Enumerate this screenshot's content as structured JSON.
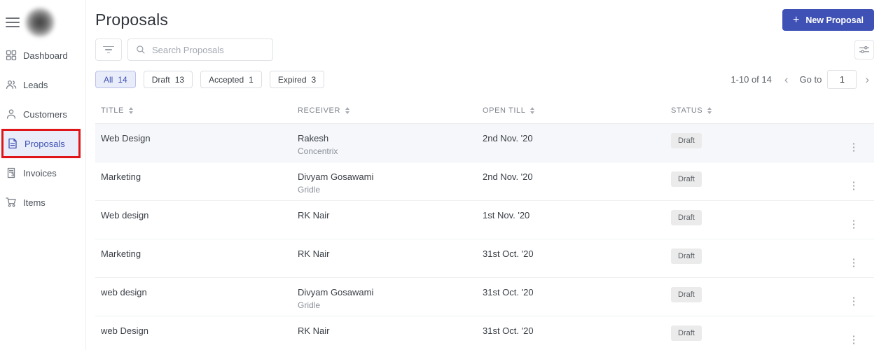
{
  "colors": {
    "accent": "#3f51b5",
    "annotation_red": "#e0151a",
    "chip_active_bg": "#e9ecf9",
    "row_highlight_bg": "#f5f7fa",
    "badge_bg": "#ebebeb"
  },
  "sidebar": {
    "items": [
      {
        "label": "Dashboard",
        "icon": "dashboard-grid-icon",
        "active": false
      },
      {
        "label": "Leads",
        "icon": "leads-people-icon",
        "active": false
      },
      {
        "label": "Customers",
        "icon": "customer-person-icon",
        "active": false
      },
      {
        "label": "Proposals",
        "icon": "proposal-document-icon",
        "active": true,
        "annotated": true
      },
      {
        "label": "Invoices",
        "icon": "invoice-receipt-icon",
        "active": false
      },
      {
        "label": "Items",
        "icon": "cart-icon",
        "active": false
      }
    ]
  },
  "header": {
    "title": "Proposals",
    "new_button": {
      "label": "New Proposal",
      "icon": "plus-icon",
      "plus": "+"
    }
  },
  "toolbar": {
    "search_placeholder": "Search Proposals"
  },
  "filters": {
    "chips": [
      {
        "label": "All",
        "count": "14",
        "active": true
      },
      {
        "label": "Draft",
        "count": "13",
        "active": false
      },
      {
        "label": "Accepted",
        "count": "1",
        "active": false
      },
      {
        "label": "Expired",
        "count": "3",
        "active": false
      }
    ]
  },
  "pagination": {
    "range": "1-10 of 14",
    "prev": "‹",
    "goto_label": "Go to",
    "page_value": "1",
    "next": "›"
  },
  "table": {
    "columns": [
      "TITLE",
      "RECEIVER",
      "OPEN TILL",
      "STATUS"
    ],
    "kebab_glyph": "⋮",
    "rows": [
      {
        "title": "Web Design",
        "receiver": "Rakesh",
        "company": "Concentrix",
        "open_till": "2nd Nov. '20",
        "status": "Draft",
        "highlighted": true
      },
      {
        "title": "Marketing",
        "receiver": "Divyam Gosawami",
        "company": "Gridle",
        "open_till": "2nd Nov. '20",
        "status": "Draft",
        "highlighted": false
      },
      {
        "title": "Web design",
        "receiver": "RK Nair",
        "company": "",
        "open_till": "1st Nov. '20",
        "status": "Draft",
        "highlighted": false
      },
      {
        "title": "Marketing",
        "receiver": "RK Nair",
        "company": "",
        "open_till": "31st Oct. '20",
        "status": "Draft",
        "highlighted": false
      },
      {
        "title": "web design",
        "receiver": "Divyam Gosawami",
        "company": "Gridle",
        "open_till": "31st Oct. '20",
        "status": "Draft",
        "highlighted": false
      },
      {
        "title": "web Design",
        "receiver": "RK Nair",
        "company": "",
        "open_till": "31st Oct. '20",
        "status": "Draft",
        "highlighted": false
      }
    ]
  }
}
